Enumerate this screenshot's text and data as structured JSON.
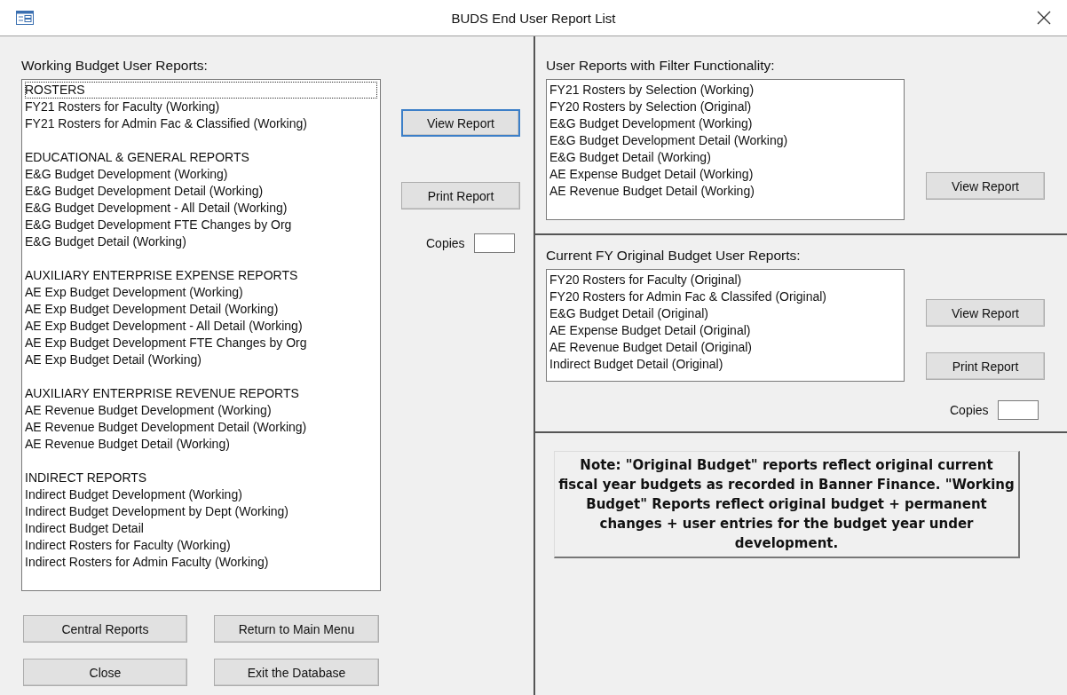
{
  "window": {
    "title": "BUDS End User Report List"
  },
  "working": {
    "label": "Working Budget User Reports:",
    "groups": [
      {
        "heading": {
          "text": "ROSTERS",
          "focused": true
        },
        "items": [
          "FY21 Rosters for Faculty (Working)",
          "FY21 Rosters for Admin Fac & Classified (Working)"
        ]
      },
      {
        "heading": {
          "text": "EDUCATIONAL & GENERAL REPORTS",
          "focused": false
        },
        "items": [
          "E&G Budget Development (Working)",
          "E&G Budget Development Detail (Working)",
          "E&G Budget Development - All Detail (Working)",
          "E&G Budget Development FTE Changes by Org",
          "E&G Budget Detail (Working)"
        ]
      },
      {
        "heading": {
          "text": "AUXILIARY ENTERPRISE EXPENSE REPORTS",
          "focused": false
        },
        "items": [
          "AE Exp Budget Development (Working)",
          "AE Exp Budget Development Detail (Working)",
          "AE Exp Budget Development - All Detail (Working)",
          "AE Exp Budget Development FTE Changes by Org",
          "AE Exp Budget Detail (Working)"
        ]
      },
      {
        "heading": {
          "text": "AUXILIARY ENTERPRISE REVENUE REPORTS",
          "focused": false
        },
        "items": [
          "AE Revenue Budget Development (Working)",
          "AE Revenue Budget Development Detail (Working)",
          "AE Revenue Budget Detail (Working)"
        ]
      },
      {
        "heading": {
          "text": "INDIRECT REPORTS",
          "focused": false
        },
        "items": [
          "Indirect Budget Development (Working)",
          "Indirect Budget Development by Dept (Working)",
          "Indirect Budget Detail",
          "Indirect Rosters for Faculty (Working)",
          "Indirect Rosters for Admin Faculty (Working)"
        ]
      }
    ],
    "view_button": {
      "label": "View Report",
      "default": true
    },
    "print_button": {
      "label": "Print Report",
      "default": false
    },
    "copies_label": "Copies"
  },
  "filter": {
    "label": "User Reports with Filter Functionality:",
    "items": [
      "FY21 Rosters by Selection (Working)",
      "FY20 Rosters by Selection (Original)",
      "E&G Budget Development (Working)",
      "E&G Budget Development Detail (Working)",
      "E&G Budget Detail (Working)",
      "AE Expense Budget Detail (Working)",
      "AE Revenue Budget Detail (Working)"
    ],
    "view_button": {
      "label": "View Report",
      "default": false
    }
  },
  "original": {
    "label": "Current FY Original Budget User Reports:",
    "items": [
      "FY20 Rosters for Faculty (Original)",
      "FY20 Rosters for Admin Fac & Classifed (Original)",
      "E&G Budget Detail (Original)",
      "AE Expense Budget Detail (Original)",
      "AE Revenue Budget Detail (Original)",
      "Indirect Budget Detail (Original)"
    ],
    "view_button": {
      "label": "View Report",
      "default": false
    },
    "print_button": {
      "label": "Print Report",
      "default": false
    },
    "copies_label": "Copies"
  },
  "note": "Note: \"Original Budget\" reports reflect original current fiscal year budgets as recorded in Banner Finance. \"Working Budget\" Reports reflect original budget + permanent changes + user entries for the budget year under development.",
  "bottom_buttons": [
    {
      "label": "Central Reports",
      "default": false
    },
    {
      "label": "Return to Main Menu",
      "default": false
    },
    {
      "label": "Close",
      "default": false
    },
    {
      "label": "Exit the Database",
      "default": false
    }
  ]
}
